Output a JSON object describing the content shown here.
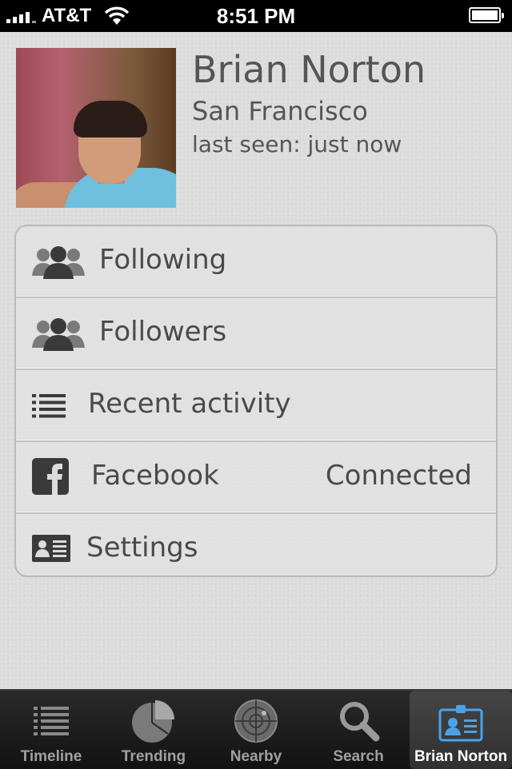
{
  "status_bar": {
    "carrier": "AT&T",
    "time": "8:51 PM"
  },
  "profile": {
    "name": "Brian Norton",
    "location": "San Francisco",
    "last_seen": "last seen: just now"
  },
  "menu": {
    "items": [
      {
        "label": "Following",
        "icon": "people-icon"
      },
      {
        "label": "Followers",
        "icon": "people-icon"
      },
      {
        "label": "Recent activity",
        "icon": "list-icon"
      },
      {
        "label": "Facebook",
        "icon": "facebook-icon",
        "value": "Connected"
      },
      {
        "label": "Settings",
        "icon": "id-card-icon"
      }
    ]
  },
  "tab_bar": {
    "tabs": [
      {
        "label": "Timeline",
        "icon": "list-icon"
      },
      {
        "label": "Trending",
        "icon": "pie-chart-icon"
      },
      {
        "label": "Nearby",
        "icon": "radar-icon"
      },
      {
        "label": "Search",
        "icon": "magnifier-icon"
      },
      {
        "label": "Brian Norton",
        "icon": "id-badge-icon"
      }
    ],
    "active_index": 4,
    "active_color": "#4aa3e8"
  }
}
